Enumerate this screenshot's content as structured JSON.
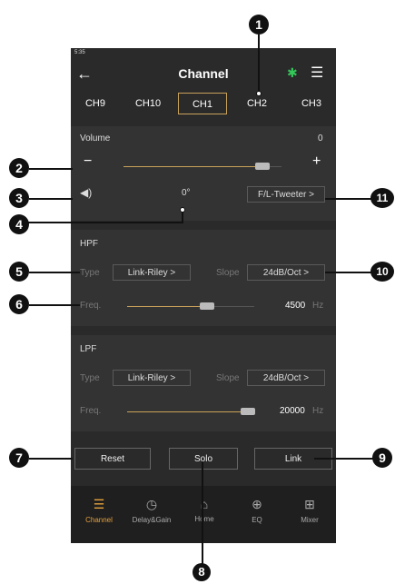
{
  "status": {
    "time": "5:35"
  },
  "topbar": {
    "title": "Channel"
  },
  "tabs": [
    "CH9",
    "CH10",
    "CH1",
    "CH2",
    "CH3"
  ],
  "volume": {
    "label": "Volume",
    "value": "0",
    "minus": "−",
    "plus": "+",
    "level": 0.88
  },
  "phase": {
    "value": "0°",
    "speaker_select": "F/L-Tweeter >"
  },
  "hpf": {
    "title": "HPF",
    "type_label": "Type",
    "type_value": "Link-Riley >",
    "slope_label": "Slope",
    "slope_value": "24dB/Oct >",
    "freq_label": "Freq.",
    "freq_value": "4500",
    "freq_unit": "Hz",
    "level": 0.63
  },
  "lpf": {
    "title": "LPF",
    "type_label": "Type",
    "type_value": "Link-Riley >",
    "slope_label": "Slope",
    "slope_value": "24dB/Oct >",
    "freq_label": "Freq.",
    "freq_value": "20000",
    "freq_unit": "Hz",
    "level": 0.95
  },
  "buttons": {
    "reset": "Reset",
    "solo": "Solo",
    "link": "Link"
  },
  "nav": [
    {
      "label": "Channel"
    },
    {
      "label": "Delay&Gain"
    },
    {
      "label": "Home"
    },
    {
      "label": "EQ"
    },
    {
      "label": "Mixer"
    }
  ],
  "callouts": [
    "1",
    "2",
    "3",
    "4",
    "5",
    "6",
    "7",
    "8",
    "9",
    "10",
    "11"
  ],
  "colors": {
    "accent": "#c9a25a",
    "nav_active": "#e6a23c",
    "bluetooth": "#34c759"
  }
}
